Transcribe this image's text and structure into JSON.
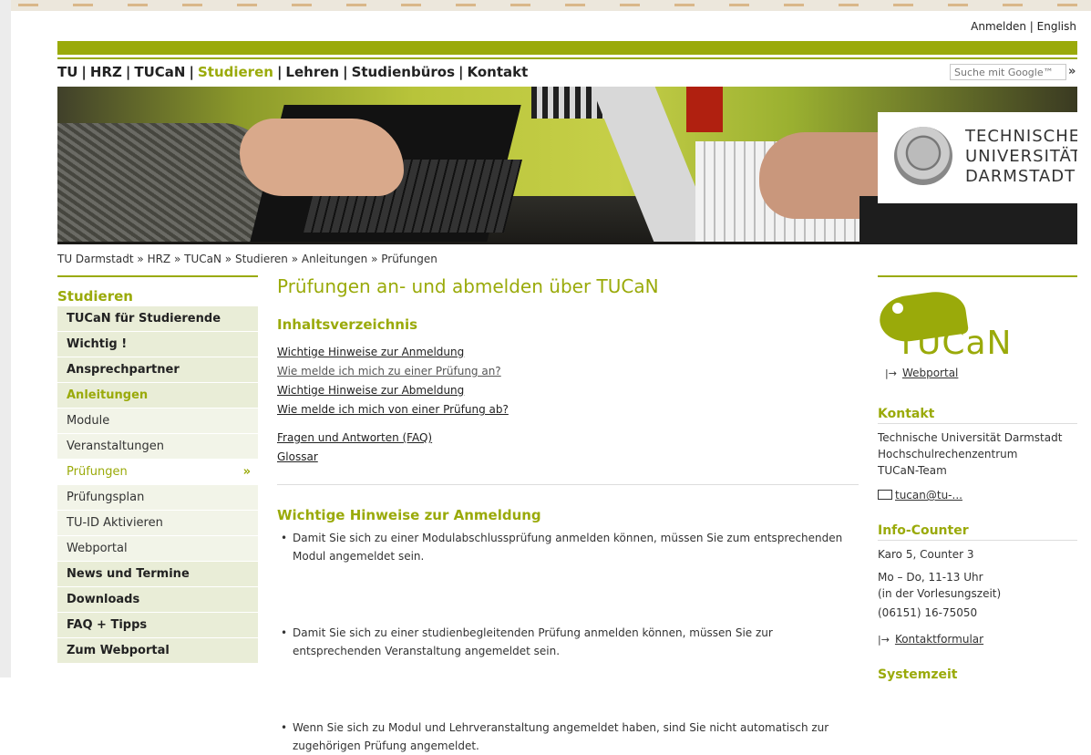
{
  "header": {
    "login": "Anmelden",
    "separator": "|",
    "language": "English",
    "search_placeholder": "Suche mit Google™",
    "search_go": "»"
  },
  "topnav": {
    "items": [
      "TU",
      "HRZ",
      "TUCaN",
      "Studieren",
      "Lehren",
      "Studienbüros",
      "Kontakt"
    ],
    "active": "Studieren"
  },
  "logo": {
    "line1": "TECHNISCHE",
    "line2": "UNIVERSITÄT",
    "line3": "DARMSTADT"
  },
  "breadcrumb": [
    "TU Darmstadt",
    "HRZ",
    "TUCaN",
    "Studieren",
    "Anleitungen",
    "Prüfungen"
  ],
  "breadcrumb_sep": " » ",
  "sidebar": {
    "heading": "Studieren",
    "items": [
      {
        "label": "TUCaN für Studierende"
      },
      {
        "label": "Wichtig !"
      },
      {
        "label": "Ansprechpartner"
      },
      {
        "label": "Anleitungen"
      },
      {
        "label": "Module"
      },
      {
        "label": "Veranstaltungen"
      },
      {
        "label": "Prüfungen",
        "marker": "»"
      },
      {
        "label": "Prüfungsplan"
      },
      {
        "label": "TU-ID Aktivieren"
      },
      {
        "label": "Webportal"
      },
      {
        "label": "News und Termine"
      },
      {
        "label": "Downloads"
      },
      {
        "label": "FAQ + Tipps"
      },
      {
        "label": "Zum Webportal"
      }
    ]
  },
  "main": {
    "title": "Prüfungen an- und abmelden über TUCaN",
    "toc_title": "Inhaltsverzeichnis",
    "toc": [
      "Wichtige Hinweise zur Anmeldung",
      "Wie melde ich mich zu einer Prüfung an?",
      "Wichtige Hinweise zur Abmeldung",
      "Wie melde ich mich von einer Prüfung ab?"
    ],
    "toc2": [
      "Fragen und Antworten (FAQ)",
      "Glossar"
    ],
    "section1_title": "Wichtige Hinweise zur Anmeldung",
    "bullets": [
      "Damit Sie sich zu einer Modulabschlussprüfung anmelden können, müssen Sie zum entsprechenden Modul angemeldet sein.",
      "Damit Sie sich zu einer studienbegleitenden Prüfung anmelden können, müssen Sie zur entsprechenden Veranstaltung angemeldet sein.",
      "Wenn Sie sich zu Modul und Lehrveranstaltung angemeldet haben, sind Sie nicht automatisch zur zugehörigen Prüfung angemeldet."
    ]
  },
  "right": {
    "tucan_logo_text": "TUCaN",
    "webportal_arrow": "|→",
    "webportal": "Webportal",
    "kontakt_title": "Kontakt",
    "kontakt_lines": [
      "Technische Universität Darmstadt",
      "Hochschulrechenzentrum",
      "TUCaN-Team"
    ],
    "mail": "tucan@tu-...",
    "info_title": "Info-Counter",
    "info_lines": [
      "Karo 5, Counter 3"
    ],
    "hours": [
      "Mo – Do, 11-13 Uhr",
      "(in der Vorlesungszeit)"
    ],
    "phone": "(06151) 16-75050",
    "kontaktformular_arrow": "|→",
    "kontaktformular": "Kontaktformular",
    "systemzeit_title": "Systemzeit"
  },
  "colors": {
    "accent": "#9aaa0a",
    "nav_bg": "#e9edd7"
  }
}
